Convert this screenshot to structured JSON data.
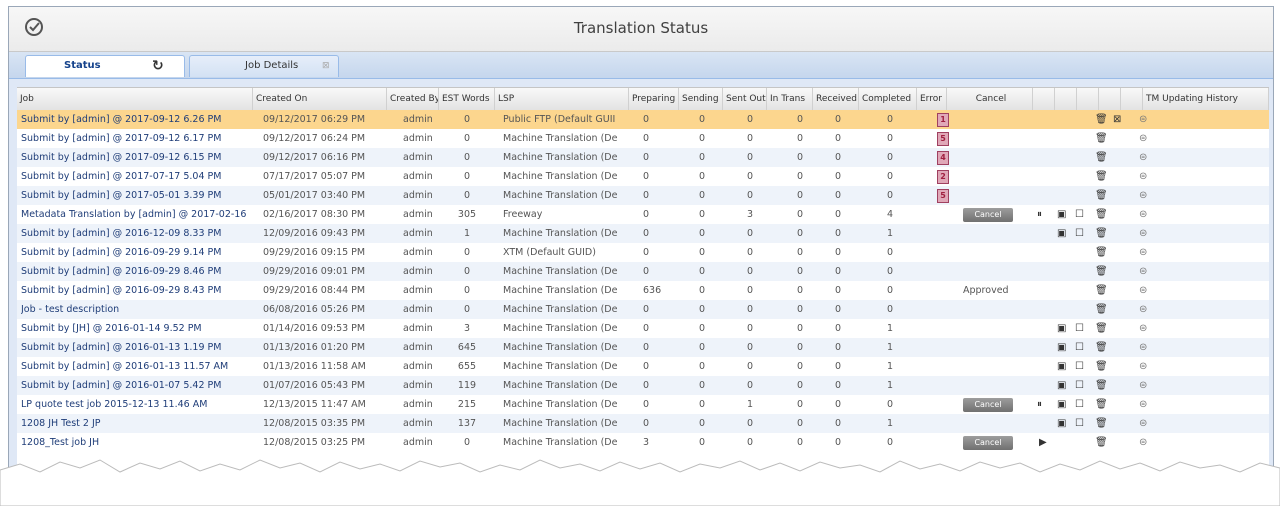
{
  "window": {
    "title": "Translation Status"
  },
  "tabs": {
    "status": "Status",
    "job_details": "Job Details"
  },
  "columns": {
    "job": "Job",
    "created_on": "Created On",
    "created_by": "Created By",
    "est_words": "EST Words",
    "lsp": "LSP",
    "preparing": "Preparing",
    "sending": "Sending",
    "sent_out": "Sent Out",
    "in_trans": "In Trans",
    "received": "Received",
    "completed": "Completed",
    "error": "Error",
    "cancel": "Cancel",
    "tm_history": "TM Updating History"
  },
  "rows": [
    {
      "job": "Submit by [admin] @ 2017-09-12 6.26 PM",
      "created": "09/12/2017 06:29 PM",
      "by": "admin",
      "est": "0",
      "lsp": "Public FTP (Default GUII",
      "prep": "0",
      "send": "0",
      "sent": "0",
      "intrans": "0",
      "recv": "0",
      "comp": "0",
      "err": "1",
      "cancel": "",
      "actions": [
        "trash",
        "x"
      ]
    },
    {
      "job": "Submit by [admin] @ 2017-09-12 6.17 PM",
      "created": "09/12/2017 06:24 PM",
      "by": "admin",
      "est": "0",
      "lsp": "Machine Translation (De",
      "prep": "0",
      "send": "0",
      "sent": "0",
      "intrans": "0",
      "recv": "0",
      "comp": "0",
      "err": "5",
      "cancel": "",
      "actions": [
        "trash"
      ]
    },
    {
      "job": "Submit by [admin] @ 2017-09-12 6.15 PM",
      "created": "09/12/2017 06:16 PM",
      "by": "admin",
      "est": "0",
      "lsp": "Machine Translation (De",
      "prep": "0",
      "send": "0",
      "sent": "0",
      "intrans": "0",
      "recv": "0",
      "comp": "0",
      "err": "4",
      "cancel": "",
      "actions": [
        "trash"
      ]
    },
    {
      "job": "Submit by [admin] @ 2017-07-17 5.04 PM",
      "created": "07/17/2017 05:07 PM",
      "by": "admin",
      "est": "0",
      "lsp": "Machine Translation (De",
      "prep": "0",
      "send": "0",
      "sent": "0",
      "intrans": "0",
      "recv": "0",
      "comp": "0",
      "err": "2",
      "cancel": "",
      "actions": [
        "trash"
      ]
    },
    {
      "job": "Submit by [admin] @ 2017-05-01 3.39 PM",
      "created": "05/01/2017 03:40 PM",
      "by": "admin",
      "est": "0",
      "lsp": "Machine Translation (De",
      "prep": "0",
      "send": "0",
      "sent": "0",
      "intrans": "0",
      "recv": "0",
      "comp": "0",
      "err": "5",
      "cancel": "",
      "actions": [
        "trash"
      ]
    },
    {
      "job": "Metadata Translation by [admin] @ 2017-02-16",
      "created": "02/16/2017 08:30 PM",
      "by": "admin",
      "est": "305",
      "lsp": "Freeway",
      "prep": "0",
      "send": "0",
      "sent": "3",
      "intrans": "0",
      "recv": "0",
      "comp": "4",
      "err": "",
      "cancel": "button",
      "actions": [
        "pause",
        "save",
        "box",
        "trash"
      ]
    },
    {
      "job": "Submit by [admin] @ 2016-12-09 8.33 PM",
      "created": "12/09/2016 09:43 PM",
      "by": "admin",
      "est": "1",
      "lsp": "Machine Translation (De",
      "prep": "0",
      "send": "0",
      "sent": "0",
      "intrans": "0",
      "recv": "0",
      "comp": "1",
      "err": "",
      "cancel": "",
      "actions": [
        "save",
        "box",
        "trash"
      ]
    },
    {
      "job": "Submit by [admin] @ 2016-09-29 9.14 PM",
      "created": "09/29/2016 09:15 PM",
      "by": "admin",
      "est": "0",
      "lsp": "XTM (Default GUID)",
      "prep": "0",
      "send": "0",
      "sent": "0",
      "intrans": "0",
      "recv": "0",
      "comp": "0",
      "err": "",
      "cancel": "",
      "actions": [
        "trash"
      ]
    },
    {
      "job": "Submit by [admin] @ 2016-09-29 8.46 PM",
      "created": "09/29/2016 09:01 PM",
      "by": "admin",
      "est": "0",
      "lsp": "Machine Translation (De",
      "prep": "0",
      "send": "0",
      "sent": "0",
      "intrans": "0",
      "recv": "0",
      "comp": "0",
      "err": "",
      "cancel": "",
      "actions": [
        "trash"
      ]
    },
    {
      "job": "Submit by [admin] @ 2016-09-29 8.43 PM",
      "created": "09/29/2016 08:44 PM",
      "by": "admin",
      "est": "0",
      "lsp": "Machine Translation (De",
      "prep": "636",
      "send": "0",
      "sent": "0",
      "intrans": "0",
      "recv": "0",
      "comp": "0",
      "err": "",
      "cancel": "Approved",
      "actions": [
        "trash"
      ]
    },
    {
      "job": "Job - test description",
      "created": "06/08/2016 05:26 PM",
      "by": "admin",
      "est": "0",
      "lsp": "Machine Translation (De",
      "prep": "0",
      "send": "0",
      "sent": "0",
      "intrans": "0",
      "recv": "0",
      "comp": "0",
      "err": "",
      "cancel": "",
      "actions": [
        "trash"
      ]
    },
    {
      "job": "Submit by [JH] @ 2016-01-14 9.52 PM",
      "created": "01/14/2016 09:53 PM",
      "by": "admin",
      "est": "3",
      "lsp": "Machine Translation (De",
      "prep": "0",
      "send": "0",
      "sent": "0",
      "intrans": "0",
      "recv": "0",
      "comp": "1",
      "err": "",
      "cancel": "",
      "actions": [
        "save",
        "box",
        "trash"
      ]
    },
    {
      "job": "Submit by [admin] @ 2016-01-13 1.19 PM",
      "created": "01/13/2016 01:20 PM",
      "by": "admin",
      "est": "645",
      "lsp": "Machine Translation (De",
      "prep": "0",
      "send": "0",
      "sent": "0",
      "intrans": "0",
      "recv": "0",
      "comp": "1",
      "err": "",
      "cancel": "",
      "actions": [
        "save",
        "box",
        "trash"
      ]
    },
    {
      "job": "Submit by [admin] @ 2016-01-13 11.57 AM",
      "created": "01/13/2016 11:58 AM",
      "by": "admin",
      "est": "655",
      "lsp": "Machine Translation (De",
      "prep": "0",
      "send": "0",
      "sent": "0",
      "intrans": "0",
      "recv": "0",
      "comp": "1",
      "err": "",
      "cancel": "",
      "actions": [
        "save",
        "box",
        "trash"
      ]
    },
    {
      "job": "Submit by [admin] @ 2016-01-07 5.42 PM",
      "created": "01/07/2016 05:43 PM",
      "by": "admin",
      "est": "119",
      "lsp": "Machine Translation (De",
      "prep": "0",
      "send": "0",
      "sent": "0",
      "intrans": "0",
      "recv": "0",
      "comp": "1",
      "err": "",
      "cancel": "",
      "actions": [
        "save",
        "box",
        "trash"
      ]
    },
    {
      "job": "LP quote test job 2015-12-13 11.46 AM",
      "created": "12/13/2015 11:47 AM",
      "by": "admin",
      "est": "215",
      "lsp": "Machine Translation (De",
      "prep": "0",
      "send": "0",
      "sent": "1",
      "intrans": "0",
      "recv": "0",
      "comp": "0",
      "err": "",
      "cancel": "button",
      "actions": [
        "pause",
        "save",
        "box",
        "trash"
      ]
    },
    {
      "job": "1208 JH Test 2 JP",
      "created": "12/08/2015 03:35 PM",
      "by": "admin",
      "est": "137",
      "lsp": "Machine Translation (De",
      "prep": "0",
      "send": "0",
      "sent": "0",
      "intrans": "0",
      "recv": "0",
      "comp": "1",
      "err": "",
      "cancel": "",
      "actions": [
        "save",
        "box",
        "trash"
      ]
    },
    {
      "job": "1208_Test job JH",
      "created": "12/08/2015 03:25 PM",
      "by": "admin",
      "est": "0",
      "lsp": "Machine Translation (De",
      "prep": "3",
      "send": "0",
      "sent": "0",
      "intrans": "0",
      "recv": "0",
      "comp": "0",
      "err": "",
      "cancel": "button",
      "actions": [
        "play",
        "trash"
      ]
    }
  ],
  "cancel_label": "Cancel",
  "colors": {
    "selected_row": "#fcd68e",
    "alt_row": "#eef3fa",
    "link": "#1f3d78"
  }
}
